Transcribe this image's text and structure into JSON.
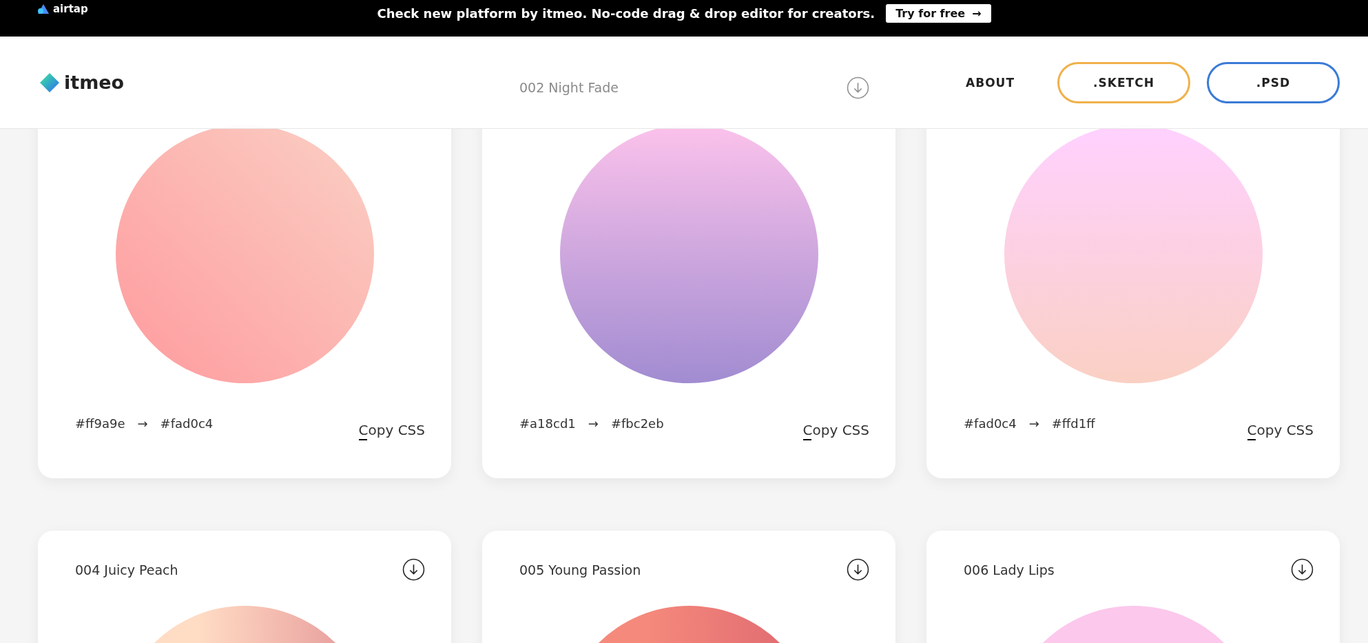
{
  "banner": {
    "brand": "airtap",
    "message": "Check new platform by itmeo. No-code drag & drop editor for creators.",
    "cta": {
      "label": "Try for free",
      "arrow": "→"
    }
  },
  "header": {
    "logo": "itmeo",
    "nav": [
      {
        "label": "ABOUT",
        "kind": "link"
      },
      {
        "label": ".SKETCH",
        "kind": "sketch"
      },
      {
        "label": ".PSD",
        "kind": "psd"
      }
    ]
  },
  "rows": [
    {
      "cards": [
        {
          "kind": "diagonal",
          "from": "#ff9a9e",
          "arrow": "→",
          "to": "#fad0c4",
          "copy": "Copy CSS"
        },
        {
          "title": "002 Night Fade",
          "download": true,
          "kind": "rising",
          "from": "#a18cd1",
          "arrow": "→",
          "to": "#fbc2eb",
          "copy": "Copy CSS"
        },
        {
          "kind": "rising",
          "from": "#fad0c4",
          "arrow": "→",
          "to": "#ffd1ff",
          "copy": "Copy CSS"
        }
      ]
    },
    {
      "cards": [
        {
          "title": "004 Juicy Peach",
          "download": true,
          "color": "#ffdcc4",
          "kind": "horizontal"
        },
        {
          "title": "005 Young Passion",
          "download": true,
          "color": "#f58a7c",
          "kind": "horizontal"
        },
        {
          "title": "006 Lady Lips",
          "download": true,
          "color": "#fcc8ec",
          "kind": "falling"
        }
      ]
    }
  ]
}
